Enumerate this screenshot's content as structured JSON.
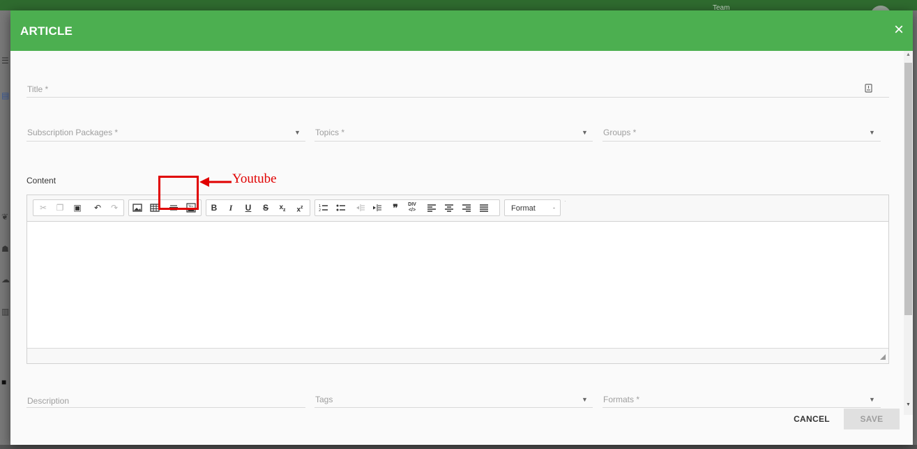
{
  "background": {
    "team_label": "Team"
  },
  "dialog": {
    "title": "ARTICLE",
    "close_glyph": "×"
  },
  "form": {
    "title_placeholder": "Title *",
    "subscription_placeholder": "Subscription Packages *",
    "topics_placeholder": "Topics *",
    "groups_placeholder": "Groups *",
    "content_label": "Content",
    "description_placeholder": "Description",
    "tags_placeholder": "Tags",
    "formats_placeholder": "Formats *",
    "dropdown_arrow": "▼"
  },
  "editor": {
    "toolbar_groups": [
      {
        "name": "clipboard",
        "buttons": [
          "cut-icon",
          "copy-icon",
          "paste-icon",
          "undo-icon",
          "redo-icon"
        ]
      },
      {
        "name": "insert",
        "buttons": [
          "image-icon",
          "table-icon",
          "horizontal-rule-icon",
          "youtube-icon"
        ]
      },
      {
        "name": "basicstyles",
        "buttons": [
          "bold-icon",
          "italic-icon",
          "underline-icon",
          "strike-icon",
          "subscript-icon",
          "superscript-icon"
        ]
      },
      {
        "name": "paragraph",
        "buttons": [
          "numbered-list-icon",
          "bulleted-list-icon",
          "outdent-icon",
          "indent-icon",
          "blockquote-icon",
          "div-icon",
          "align-left-icon",
          "align-center-icon",
          "align-right-icon",
          "justify-icon"
        ]
      }
    ],
    "format_label": "Format",
    "format_arrow": "-"
  },
  "annotation": {
    "label": "Youtube",
    "color": "#e00000"
  },
  "actions": {
    "cancel_label": "CANCEL",
    "save_label": "SAVE"
  },
  "colors": {
    "header_green": "#4caf50",
    "save_disabled_bg": "#e0e0e0"
  }
}
